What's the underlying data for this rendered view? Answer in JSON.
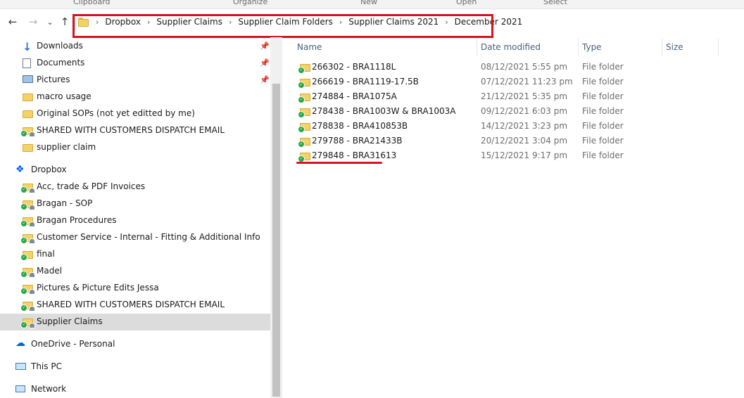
{
  "ribbon": {
    "items": [
      "Clipboard",
      "Organize",
      "New",
      "Open",
      "Select"
    ]
  },
  "nav": {
    "back": "←",
    "forward": "→",
    "recent": "⌄",
    "up": "↑"
  },
  "breadcrumb": [
    "Dropbox",
    "Supplier Claims",
    "Supplier Claim Folders",
    "Supplier Claims 2021",
    "December 2021"
  ],
  "sidebar": {
    "quick_access": [
      {
        "label": "Downloads",
        "icon": "download-arrow-icon",
        "pinned": true
      },
      {
        "label": "Documents",
        "icon": "documents-icon",
        "pinned": true
      },
      {
        "label": "Pictures",
        "icon": "pictures-icon",
        "pinned": true
      },
      {
        "label": "macro usage",
        "icon": "folder-icon"
      },
      {
        "label": "Original SOPs (not yet editted by me)",
        "icon": "folder-icon"
      },
      {
        "label": "SHARED WITH CUSTOMERS DISPATCH EMAIL",
        "icon": "shared-folder-icon"
      },
      {
        "label": "supplier claim",
        "icon": "folder-icon"
      }
    ],
    "dropbox_label": "Dropbox",
    "dropbox_items": [
      {
        "label": "Acc, trade & PDF Invoices",
        "icon": "shared-folder-icon"
      },
      {
        "label": "Bragan - SOP",
        "icon": "shared-folder-icon"
      },
      {
        "label": "Bragan Procedures",
        "icon": "shared-folder-icon"
      },
      {
        "label": "Customer Service - Internal - Fitting & Additional Info",
        "icon": "shared-folder-icon"
      },
      {
        "label": "final",
        "icon": "synced-folder-icon"
      },
      {
        "label": "Madel",
        "icon": "shared-folder-icon"
      },
      {
        "label": "Pictures & Picture Edits Jessa",
        "icon": "shared-folder-icon"
      },
      {
        "label": "SHARED WITH CUSTOMERS DISPATCH EMAIL",
        "icon": "shared-folder-icon"
      },
      {
        "label": "Supplier Claims",
        "icon": "shared-folder-icon",
        "selected": true
      }
    ],
    "onedrive_label": "OneDrive - Personal",
    "thispc_label": "This PC",
    "network_label": "Network"
  },
  "columns": {
    "name": "Name",
    "date": "Date modified",
    "type": "Type",
    "size": "Size"
  },
  "files": [
    {
      "name": "266302 - BRA1118L",
      "date": "08/12/2021 5:55 pm",
      "type": "File folder"
    },
    {
      "name": "266619 - BRA1119-17.5B",
      "date": "07/12/2021 11:23 pm",
      "type": "File folder"
    },
    {
      "name": "274884 - BRA1075A",
      "date": "21/12/2021 5:35 pm",
      "type": "File folder"
    },
    {
      "name": "278438 - BRA1003W & BRA1003A",
      "date": "09/12/2021 6:03 pm",
      "type": "File folder"
    },
    {
      "name": "278838 - BRA410853B",
      "date": "14/12/2021 3:23 pm",
      "type": "File folder"
    },
    {
      "name": "279788 - BRA21433B",
      "date": "20/12/2021 3:04 pm",
      "type": "File folder"
    },
    {
      "name": "279848 - BRA31613",
      "date": "15/12/2021 9:17 pm",
      "type": "File folder"
    }
  ],
  "colors": {
    "annotation": "#d4151f",
    "selected_bg": "#dcdcdc",
    "folder": "#f5d266",
    "sync_check": "#26a843"
  }
}
